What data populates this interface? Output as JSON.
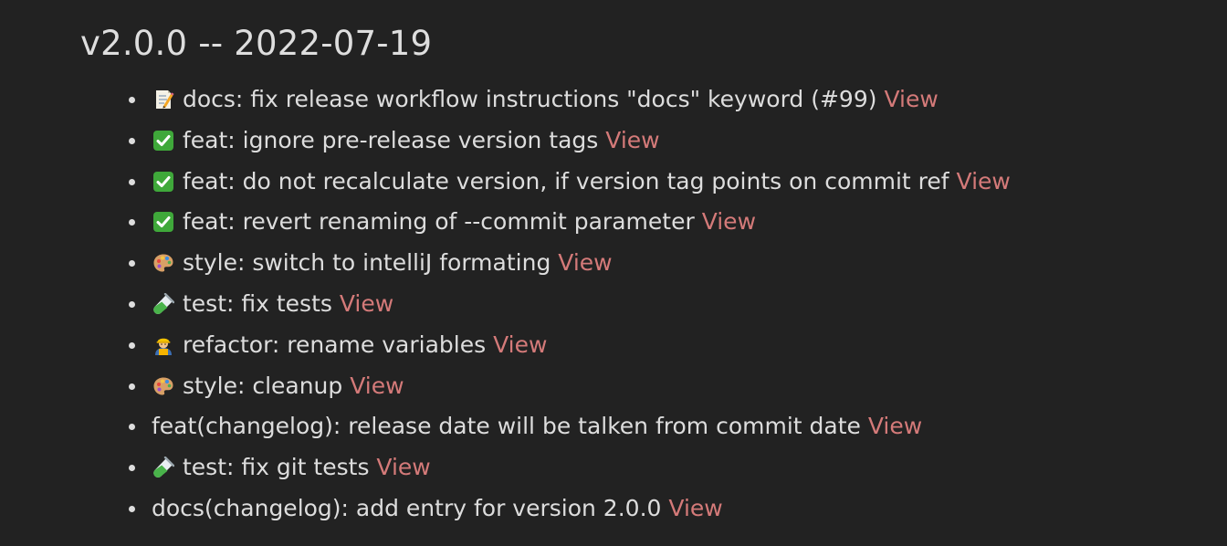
{
  "release": {
    "title": "v2.0.0 -- 2022-07-19"
  },
  "colors": {
    "background": "#222222",
    "text": "#dddddd",
    "link": "#d47a79"
  },
  "entries": [
    {
      "icon": "memo-icon",
      "text": "docs: fix release workflow instructions \"docs\" keyword (#99)",
      "link": "View"
    },
    {
      "icon": "check-mark-icon",
      "text": "feat: ignore pre-release version tags",
      "link": "View"
    },
    {
      "icon": "check-mark-icon",
      "text": "feat: do not recalculate version, if version tag points on commit ref",
      "link": "View"
    },
    {
      "icon": "check-mark-icon",
      "text": "feat: revert renaming of --commit parameter",
      "link": "View"
    },
    {
      "icon": "palette-icon",
      "text": "style: switch to intelliJ formating",
      "link": "View"
    },
    {
      "icon": "test-tube-icon",
      "text": "test: fix tests",
      "link": "View"
    },
    {
      "icon": "construction-worker-icon",
      "text": "refactor: rename variables",
      "link": "View"
    },
    {
      "icon": "palette-icon",
      "text": "style: cleanup",
      "link": "View"
    },
    {
      "icon": "",
      "text": "feat(changelog): release date will be talken from commit date",
      "link": "View"
    },
    {
      "icon": "test-tube-icon",
      "text": "test: fix git tests",
      "link": "View"
    },
    {
      "icon": "",
      "text": "docs(changelog): add entry for version 2.0.0",
      "link": "View"
    }
  ]
}
